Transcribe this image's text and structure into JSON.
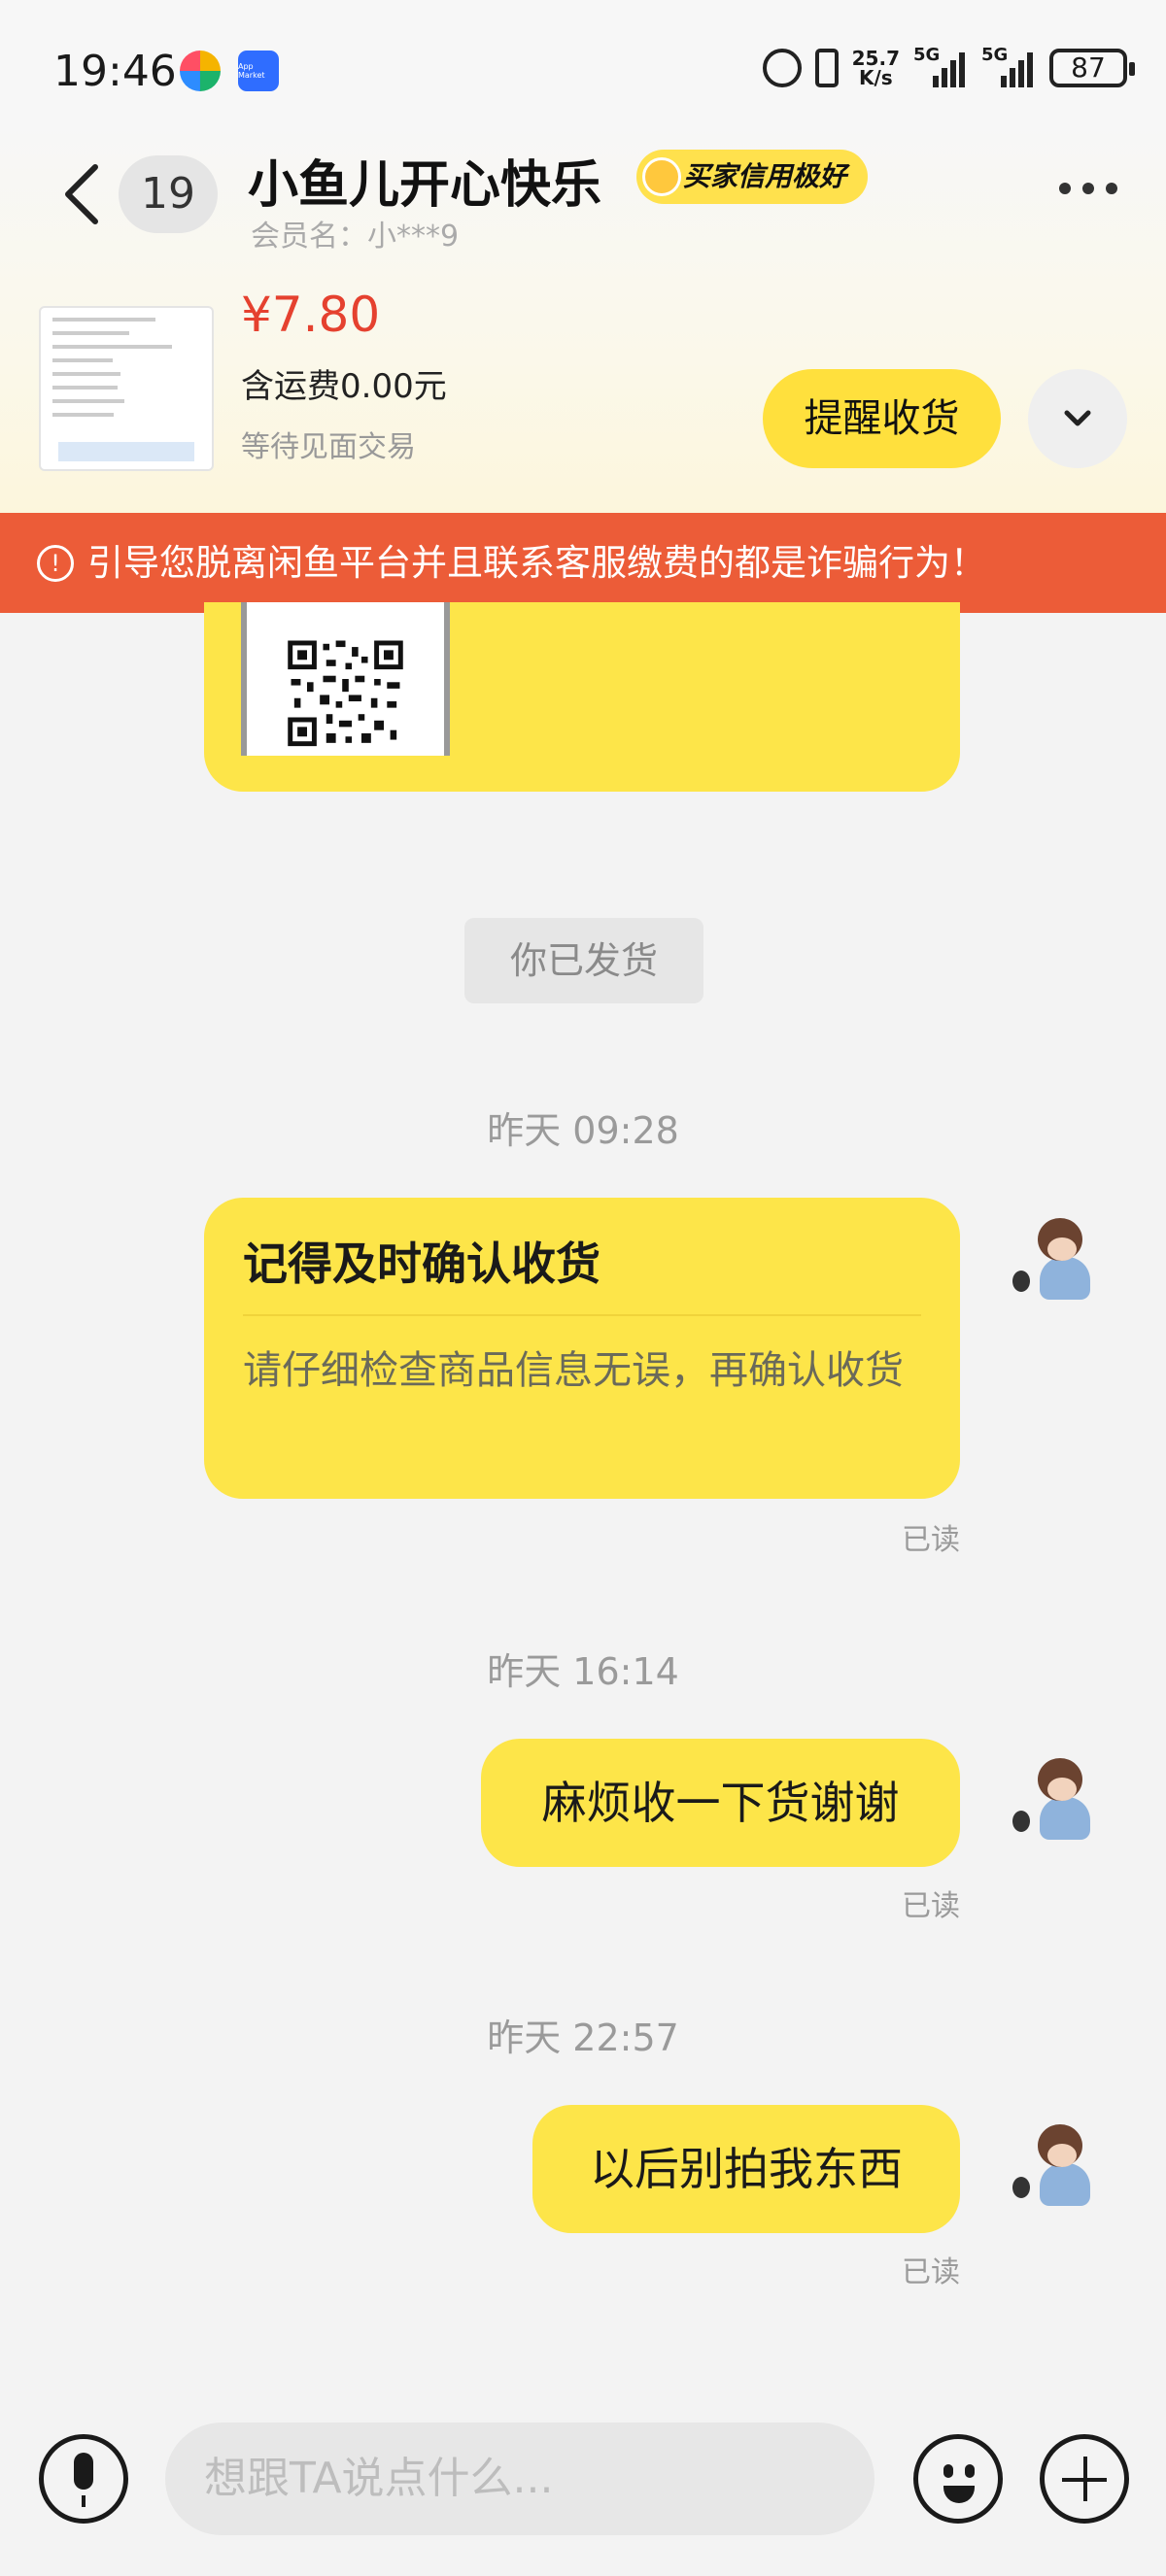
{
  "status_bar": {
    "time": "19:46",
    "app_market_label": "App Market",
    "net_speed_top": "25.7",
    "net_speed_bottom": "K/s",
    "signal1_label": "5G",
    "signal2_label": "5G",
    "battery": "87"
  },
  "header": {
    "unread_count": "19",
    "nickname": "小鱼儿开心快乐",
    "credit_badge": "买家信用极好",
    "member_label": "会员名：小***9"
  },
  "order": {
    "price": "¥7.80",
    "shipping": "含运费0.00元",
    "status": "等待见面交易",
    "remind_button": "提醒收货"
  },
  "warning": {
    "text": "引导您脱离闲鱼平台并且联系客服缴费的都是诈骗行为！",
    "icon": "!"
  },
  "chat": {
    "system_note": "你已发货",
    "card": {
      "timestamp": "昨天 09:28",
      "title": "记得及时确认收货",
      "body": "请仔细检查商品信息无误，再确认收货",
      "read": "已读"
    },
    "messages": [
      {
        "timestamp": "昨天 16:14",
        "text": "麻烦收一下货谢谢",
        "read": "已读"
      },
      {
        "timestamp": "昨天 22:57",
        "text": "以后别拍我东西",
        "read": "已读"
      }
    ]
  },
  "input": {
    "placeholder": "想跟TA说点什么..."
  },
  "colors": {
    "accent_yellow": "#fde549",
    "warning_red": "#ec5c38",
    "price_red": "#e5412f"
  },
  "icons": [
    "back-icon",
    "more-icon",
    "chevron-down-icon",
    "mic-icon",
    "emoji-icon",
    "plus-icon",
    "alarm-icon",
    "vibrate-icon",
    "battery-icon"
  ]
}
